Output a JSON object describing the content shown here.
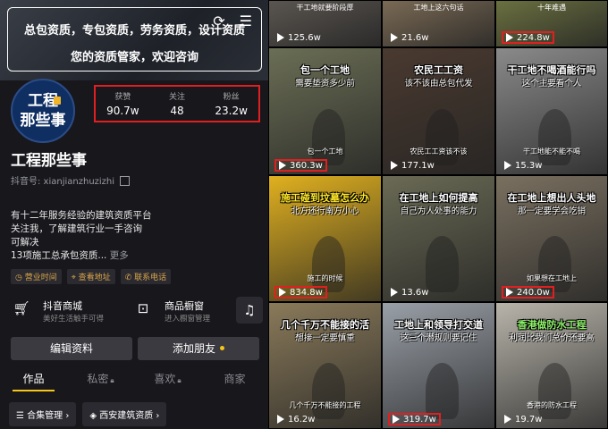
{
  "banner": {
    "line1": "总包资质，专包资质，劳务资质，设计资质",
    "line2": "您的资质管家，欢迎咨询"
  },
  "avatar": {
    "line1": "工程",
    "line2": "那些事"
  },
  "stats": [
    {
      "label": "获赞",
      "value": "90.7w"
    },
    {
      "label": "关注",
      "value": "48"
    },
    {
      "label": "粉丝",
      "value": "23.2w"
    }
  ],
  "profile": {
    "name": "工程那些事",
    "handle": "抖音号: xianjianzhuzizhi",
    "bio": [
      "有十二年服务经验的建筑资质平台",
      "关注我，了解建筑行业一手咨询",
      "可解决",
      "13项施工总承包资质..."
    ],
    "bio_more": "更多"
  },
  "chips": [
    "营业时间",
    "查看地址",
    "联系电话"
  ],
  "services": {
    "shop": {
      "title": "抖音商城",
      "sub": "美好生活触手可得"
    },
    "window": {
      "title": "商品橱窗",
      "sub": "进入橱窗管理"
    }
  },
  "buttons": {
    "edit": "编辑资料",
    "add": "添加朋友"
  },
  "tabs": [
    "作品",
    "私密",
    "喜欢",
    "商家"
  ],
  "bottom_chips": [
    "合集管理",
    "西安建筑资质"
  ],
  "videos": [
    {
      "title": "",
      "subtitle": "",
      "top": "干工地就要阶段厚",
      "views": "125.6w",
      "highlight": false,
      "color": "#5a5550"
    },
    {
      "title": "",
      "subtitle": "",
      "top": "工地上这六句话",
      "views": "21.6w",
      "highlight": false,
      "color": "#7a6a55"
    },
    {
      "title": "",
      "subtitle": "",
      "top": "十年难遇",
      "views": "224.8w",
      "highlight": true,
      "color": "#6a7040"
    },
    {
      "title": "包一个工地",
      "subtitle": "需要垫资多少前",
      "top": "",
      "views": "360.3w",
      "highlight": true,
      "color": "#6b6e55"
    },
    {
      "title": "农民工工资",
      "subtitle": "该不该由总包代发",
      "top": "",
      "views": "177.1w",
      "highlight": false,
      "color": "#4a3a30"
    },
    {
      "title": "干工地不喝酒能行吗",
      "subtitle": "这个主要看个人",
      "top": "",
      "views": "15.3w",
      "highlight": false,
      "color": "#8a8a8a"
    },
    {
      "title": "施工碰到坟墓怎么办",
      "subtitle": "北方还行南方小心",
      "top": "",
      "views": "834.8w",
      "highlight": true,
      "color": "#e0b020"
    },
    {
      "title": "在工地上如何提高",
      "subtitle": "自己为人处事的能力",
      "top": "",
      "views": "13.6w",
      "highlight": false,
      "color": "#6a6a55"
    },
    {
      "title": "在工地上想出人头地",
      "subtitle": "那一定要学会吃销",
      "top": "",
      "views": "240.0w",
      "highlight": true,
      "color": "#7a7060"
    },
    {
      "title": "几个千万不能接的活",
      "subtitle": "想接一定要慎重",
      "top": "",
      "views": "16.2w",
      "highlight": false,
      "color": "#8a7a5a"
    },
    {
      "title": "工地上和领导打交道",
      "subtitle": "这三个潜规则要记住",
      "top": "",
      "views": "319.7w",
      "highlight": true,
      "color": "#9aa0a8"
    },
    {
      "title": "香港做防水工程",
      "subtitle": "利润比我们总价还要高",
      "top": "",
      "views": "19.7w",
      "highlight": false,
      "color": "#b8b4aa"
    }
  ],
  "video_subs": [
    "",
    "",
    "",
    "包一个工地",
    "农民工工资该不该",
    "干工地能不能不喝",
    "施工的时候",
    "",
    "如果想在工地上",
    "几个千万不能接的工程",
    "",
    "香港的防水工程"
  ],
  "colors": {
    "accent": "#f5c518",
    "highlight": "#e02020"
  }
}
